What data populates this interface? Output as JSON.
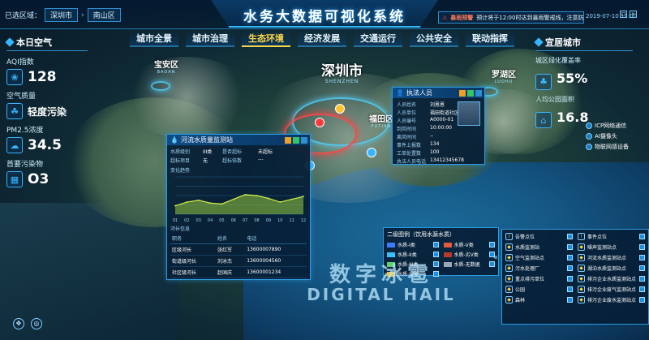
{
  "header": {
    "title": "水务大数据可视化系统",
    "region_label": "已选区域：",
    "region_city": "深圳市",
    "region_district": "南山区",
    "alert_tag": "暴雨预警",
    "alert_text": "预计将于12:00时达到暴雨警戒线，注意防范",
    "datetime": "2019-07-10 12:00",
    "colors": {
      "accent": "#37b6ff",
      "active": "#ffd74a",
      "alert": "#ff4f3d"
    }
  },
  "nav": {
    "tabs": [
      "城市全景",
      "城市治理",
      "生态环境",
      "经济发展",
      "交通运行",
      "公共安全",
      "联动指挥"
    ],
    "active": "生态环境"
  },
  "left": {
    "title": "本日空气",
    "aqi_label": "AQI指数",
    "aqi_value": "128",
    "quality_label": "空气质量",
    "quality_value": "轻度污染",
    "pm_label": "PM2.5浓度",
    "pm_value": "34.5",
    "pollutant_label": "首要污染物",
    "pollutant_value": "O3"
  },
  "right": {
    "title": "宜居城市",
    "green_label": "城区绿化覆盖率",
    "green_value": "55%",
    "park_label": "人均公园面积",
    "park_value": "16.8",
    "layers": [
      "ICP网络通信",
      "AI摄像头",
      "物联网感设备"
    ]
  },
  "districts": {
    "baoan": {
      "cn": "宝安区",
      "en": "BAOAN"
    },
    "shenzhen": {
      "cn": "深圳市",
      "en": "SHENZHEN"
    },
    "futian": {
      "cn": "福田区",
      "en": "FUTIAN"
    },
    "luohu": {
      "cn": "罗湖区",
      "en": "LUOHU"
    }
  },
  "water_popup": {
    "title": "河流水质量监测站",
    "fields": [
      {
        "k": "水质级别",
        "v": "III类",
        "k2": "是否超标",
        "v2": "未超标"
      },
      {
        "k": "超标项目",
        "v": "无",
        "k2": "超标倍数",
        "v2": "---"
      }
    ],
    "chart_title": "变化趋势",
    "table_title": "河长信息",
    "table_headers": [
      "职务",
      "姓名",
      "电话"
    ],
    "table_rows": [
      [
        "区级河长",
        "张红军",
        "13600007890"
      ],
      [
        "街道级河长",
        "刘冰杰",
        "13600004560"
      ],
      [
        "社区级河长",
        "赵国庆",
        "13600001234"
      ]
    ]
  },
  "law_popup": {
    "title": "执法人员",
    "fields": [
      {
        "k": "人员姓名",
        "v": "刘恩恩"
      },
      {
        "k": "人员单位",
        "v": "福田街道社区"
      },
      {
        "k": "人员编号",
        "v": "A0000-01"
      },
      {
        "k": "到岗时间",
        "v": "10:00:00"
      },
      {
        "k": "离岗时间",
        "v": "--"
      },
      {
        "k": "事件上报数",
        "v": "134"
      },
      {
        "k": "工单处置数",
        "v": "100"
      },
      {
        "k": "执法人员电话",
        "v": "13412345678"
      }
    ]
  },
  "legend_water": {
    "title": "二级图例（饮用水源水质）",
    "items": [
      {
        "label": "水质-I类",
        "color": "#3b7bff"
      },
      {
        "label": "水质-V类",
        "color": "#e15a3a"
      },
      {
        "label": "水质-II类",
        "color": "#38c0ff"
      },
      {
        "label": "水质-劣V类",
        "color": "#b8392b"
      },
      {
        "label": "水质-III类",
        "color": "#5fd06e"
      },
      {
        "label": "水质-无数据",
        "color": "#9aa7b3"
      },
      {
        "label": "水质-IV类",
        "color": "#f1c232"
      }
    ]
  },
  "legend_layers": {
    "items": [
      {
        "label": "告警点位",
        "icon": "!"
      },
      {
        "label": "事件点位",
        "icon": "!"
      },
      {
        "label": "水质监测站",
        "icon": "◆"
      },
      {
        "label": "噪声监测站点",
        "icon": "◆"
      },
      {
        "label": "空气监测站点",
        "icon": "◆"
      },
      {
        "label": "河流水质监测站点",
        "icon": "◆"
      },
      {
        "label": "污水处理厂",
        "icon": "◆"
      },
      {
        "label": "湖泊水质监测站点",
        "icon": "◆"
      },
      {
        "label": "重点排污单位",
        "icon": "◆"
      },
      {
        "label": "排污企业水质监测站点",
        "icon": "◆"
      },
      {
        "label": "公园",
        "icon": "◆"
      },
      {
        "label": "排污企业废气监测站点",
        "icon": "◆"
      },
      {
        "label": "森林",
        "icon": "◆"
      },
      {
        "label": "排污企业废水监测站点",
        "icon": "◆"
      }
    ]
  },
  "watermark": {
    "cn": "数字冰雹",
    "en": "DIGITAL HAIL"
  },
  "chart_data": {
    "type": "area",
    "title": "变化趋势",
    "x": [
      "01",
      "02",
      "03",
      "04",
      "05",
      "06",
      "07",
      "08",
      "09",
      "10",
      "11",
      "12"
    ],
    "series": [
      {
        "values": [
          9,
          13,
          15,
          12,
          11,
          16,
          21,
          20,
          17,
          13,
          16,
          19
        ]
      }
    ],
    "ylim": [
      0,
      40
    ],
    "grid": true
  }
}
